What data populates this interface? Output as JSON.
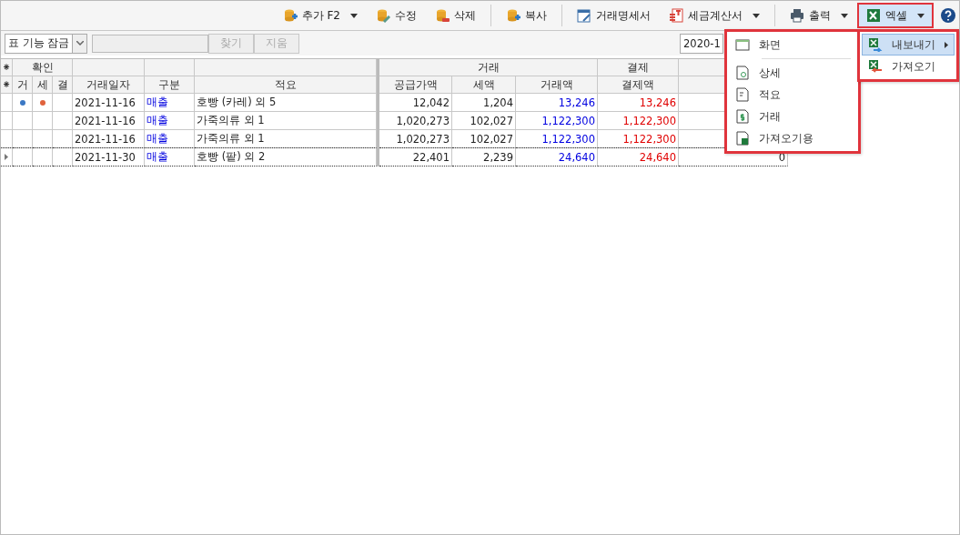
{
  "toolbar": {
    "buttons": [
      {
        "label": "추가 F2"
      },
      {
        "label": "수정"
      },
      {
        "label": "삭제"
      },
      {
        "label": "복사"
      },
      {
        "label": "거래명세서"
      },
      {
        "label": "세금계산서"
      },
      {
        "label": "출력"
      },
      {
        "label": "엑셀",
        "open": true
      }
    ]
  },
  "filter_bar": {
    "lock_select": "표 기능 잠금",
    "find_button": "찾기",
    "clear_button": "지움",
    "date_field": "2020-1"
  },
  "table": {
    "corner_marks": [
      "⁕",
      "⁕"
    ],
    "group_headers": [
      "확인",
      "거래",
      "결제"
    ],
    "columns": [
      "거",
      "세",
      "결",
      "거래일자",
      "구분",
      "적요",
      "공급가액",
      "세액",
      "거래액",
      "결제액"
    ],
    "rows": [
      {
        "selected": false,
        "geo_dot": {
          "color": "#3b78c4"
        },
        "se_dot": {
          "color": "#e0623c"
        },
        "date": "2021-11-16",
        "type": "매출",
        "summary": "호빵 (카레) 외 5",
        "supply": "12,042",
        "tax": "1,204",
        "amount": "13,246",
        "payment": "13,246"
      },
      {
        "selected": false,
        "date": "2021-11-16",
        "type": "매출",
        "summary": "가죽의류 외 1",
        "supply": "1,020,273",
        "tax": "102,027",
        "amount": "1,122,300",
        "payment": "1,122,300"
      },
      {
        "selected": false,
        "date": "2021-11-16",
        "type": "매출",
        "summary": "가죽의류 외 1",
        "supply": "1,020,273",
        "tax": "102,027",
        "amount": "1,122,300",
        "payment": "1,122,300"
      },
      {
        "selected": true,
        "date": "2021-11-30",
        "type": "매출",
        "summary": "호빵 (팥) 외 2",
        "supply": "22,401",
        "tax": "2,239",
        "amount": "24,640",
        "payment": "24,640",
        "column_11": "0"
      }
    ]
  },
  "excel_menu": {
    "items": [
      {
        "label": "내보내기",
        "selected": true
      },
      {
        "label": "가져오기",
        "selected": false
      }
    ]
  },
  "export_menu": {
    "items": [
      {
        "label": "화면"
      },
      {
        "label": "상세"
      },
      {
        "label": "적요"
      },
      {
        "label": "거래"
      },
      {
        "label": "가져오기용"
      }
    ]
  }
}
